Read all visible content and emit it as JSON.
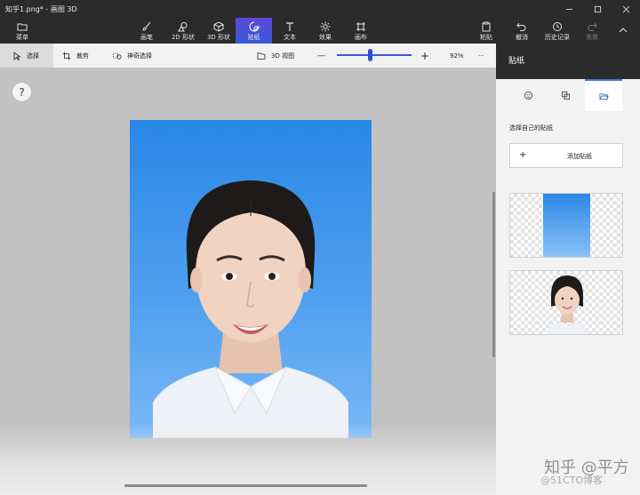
{
  "window": {
    "title": "知乎1.png* - 画图 3D"
  },
  "ribbon": {
    "menu": "菜单",
    "brushes": "画笔",
    "shapes2d": "2D 形状",
    "shapes3d": "3D 形状",
    "stickers": "贴纸",
    "text": "文本",
    "effects": "效果",
    "canvas": "画布",
    "paste": "粘贴",
    "undo": "撤消",
    "history": "历史记录",
    "redo": "重做",
    "active_color": "#4a52d8"
  },
  "toolbar": {
    "select": "选择",
    "crop": "裁剪",
    "magic_select": "神奇选择",
    "view3d": "3D 视图",
    "zoom_minus": "—",
    "zoom_plus": "+",
    "zoom_level": "92%",
    "zoom_fraction": 0.45,
    "more": "···"
  },
  "canvas": {
    "help": "?"
  },
  "panel": {
    "title": "贴纸",
    "subtitle": "选择自己的贴纸",
    "add_plus": "+",
    "add_label": "添加贴纸"
  },
  "watermark": {
    "line1": "知乎 @平方",
    "line2": "@51CTO博客"
  }
}
